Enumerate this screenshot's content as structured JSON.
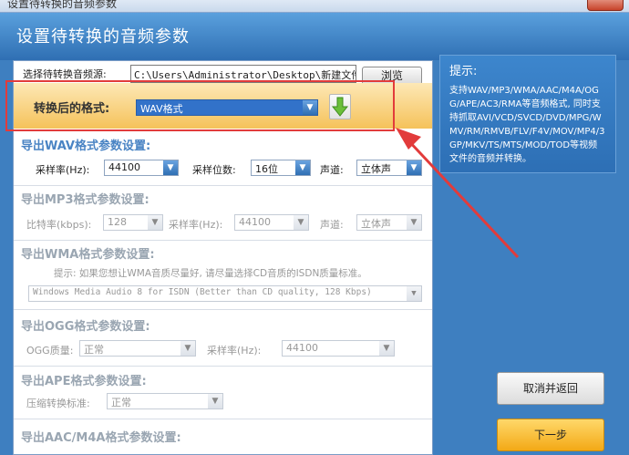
{
  "window": {
    "title": "设置待转换的音频参数"
  },
  "header": {
    "title": "设置待转换的音频参数"
  },
  "source": {
    "label": "选择待转换音频源:",
    "path": "C:\\Users\\Administrator\\Desktop\\新建文件夹",
    "browse": "浏览"
  },
  "format": {
    "label": "转换后的格式:",
    "value": "WAV格式"
  },
  "wav": {
    "title": "导出WAV格式参数设置:",
    "sample_rate_label": "采样率(Hz):",
    "sample_rate": "44100",
    "bits_label": "采样位数:",
    "bits": "16位",
    "channel_label": "声道:",
    "channel": "立体声"
  },
  "mp3": {
    "title": "导出MP3格式参数设置:",
    "bitrate_label": "比特率(kbps):",
    "bitrate": "128",
    "sample_rate_label": "采样率(Hz):",
    "sample_rate": "44100",
    "channel_label": "声道:",
    "channel": "立体声"
  },
  "wma": {
    "title": "导出WMA格式参数设置:",
    "hint": "提示: 如果您想让WMA音质尽量好, 请尽量选择CD音质的ISDN质量标准。",
    "profile": "Windows Media Audio 8 for ISDN (Better than CD quality, 128 Kbps)"
  },
  "ogg": {
    "title": "导出OGG格式参数设置:",
    "quality_label": "OGG质量:",
    "quality": "正常",
    "sample_rate_label": "采样率(Hz):",
    "sample_rate": "44100"
  },
  "ape": {
    "title": "导出APE格式参数设置:",
    "level_label": "压缩转换标准:",
    "level": "正常"
  },
  "aac": {
    "title": "导出AAC/M4A格式参数设置:"
  },
  "tips": {
    "title": "提示:",
    "body": "支持WAV/MP3/WMA/AAC/M4A/OGG/APE/AC3/RMA等音频格式, 同时支持抓取AVI/VCD/SVCD/DVD/MPG/WMV/RM/RMVB/FLV/F4V/MOV/MP4/3GP/MKV/TS/MTS/MOD/TOD等视频文件的音频并转换。"
  },
  "buttons": {
    "cancel": "取消并返回",
    "next": "下一步"
  },
  "colors": {
    "header": "#3e7fc0",
    "highlight": "#e23b3b",
    "orange": "#f5c25a"
  }
}
